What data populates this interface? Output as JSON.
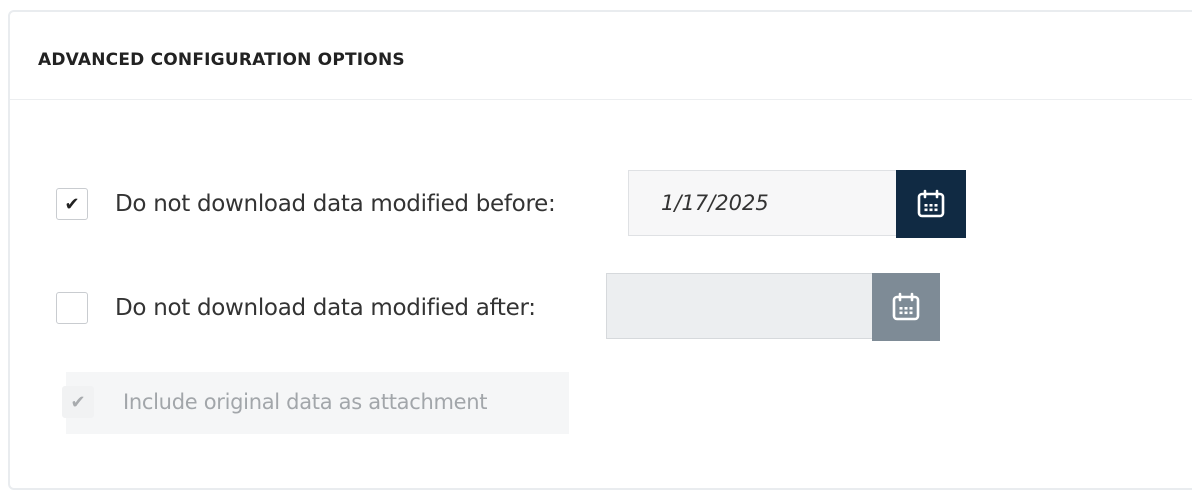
{
  "panel": {
    "title": "ADVANCED CONFIGURATION OPTIONS"
  },
  "options": {
    "before": {
      "label": "Do not download data modified before:",
      "checked": true,
      "check_glyph": "✔",
      "date_value": "1/17/2025",
      "calendar_icon": "calendar-icon"
    },
    "after": {
      "label": "Do not download data modified after:",
      "checked": false,
      "check_glyph": "",
      "date_value": "",
      "calendar_icon": "calendar-icon"
    },
    "attachment": {
      "label": "Include original data as attachment",
      "checked": true,
      "disabled": true,
      "check_glyph": "✔"
    }
  },
  "colors": {
    "calendar_button_active": "#102a43",
    "calendar_button_disabled": "#7e8b96",
    "disabled_text": "#a2a6aa"
  }
}
